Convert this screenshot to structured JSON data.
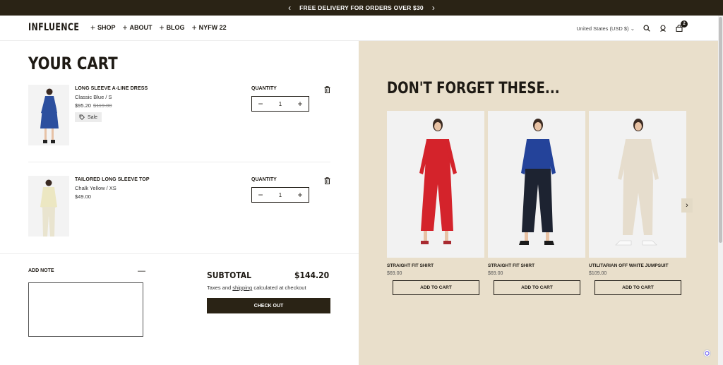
{
  "announcement": {
    "text": "FREE DELIVERY FOR ORDERS OVER $30",
    "prev_icon": "chevron-left-icon",
    "next_icon": "chevron-right-icon"
  },
  "header": {
    "logo": "INFLUENCE",
    "nav": [
      {
        "label": "SHOP"
      },
      {
        "label": "ABOUT"
      },
      {
        "label": "BLOG"
      },
      {
        "label": "NYFW 22"
      }
    ],
    "currency": "United States (USD $)",
    "cart_count": "2"
  },
  "cart": {
    "title": "YOUR CART",
    "items": [
      {
        "name": "LONG SLEEVE A-LINE DRESS",
        "variant": "Classic Blue / S",
        "price": "$95.20",
        "compare_price": "$119.00",
        "tag": "Sale",
        "quantity_label": "QUANTITY",
        "quantity": "1",
        "color": "#2c4f9e"
      },
      {
        "name": "TAILORED LONG SLEEVE TOP",
        "variant": "Chalk Yellow / XS",
        "price": "$49.00",
        "quantity_label": "QUANTITY",
        "quantity": "1",
        "color": "#ece7c2"
      }
    ],
    "note_label": "ADD NOTE",
    "note_value": "",
    "subtotal_label": "SUBTOTAL",
    "subtotal_value": "$144.20",
    "tax_prefix": "Taxes and ",
    "tax_link": "shipping",
    "tax_suffix": " calculated at checkout",
    "checkout_label": "CHECK OUT"
  },
  "upsell": {
    "title": "DON'T FORGET THESE...",
    "products": [
      {
        "name": "STRAIGHT FIT SHIRT",
        "price": "$69.00",
        "button": "ADD TO CART",
        "top_color": "#d4232b",
        "bottom_color": "#d4232b"
      },
      {
        "name": "STRAIGHT FIT SHIRT",
        "price": "$69.00",
        "button": "ADD TO CART",
        "top_color": "#24439a",
        "bottom_color": "#1d2331"
      },
      {
        "name": "UTILITARIAN OFF WHITE JUMPSUIT",
        "price": "$109.00",
        "button": "ADD TO CART",
        "top_color": "#e6ddcd",
        "bottom_color": "#e6ddcd"
      }
    ]
  }
}
